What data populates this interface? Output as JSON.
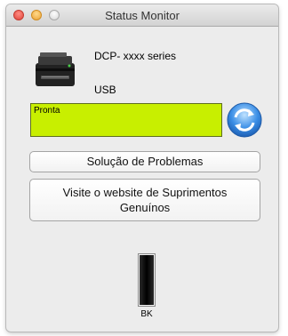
{
  "window": {
    "title": "Status Monitor"
  },
  "device": {
    "name": "DCP- xxxx series",
    "connection": "USB",
    "icon": "printer-icon"
  },
  "status": {
    "text": "Pronta",
    "color": "#c8ef00"
  },
  "buttons": {
    "refresh_icon": "refresh-icon",
    "troubleshoot": "Solução de Problemas",
    "visit_supplies_line1": "Visite o website de Suprimentos",
    "visit_supplies_line2": "Genuínos"
  },
  "toner": {
    "label": "BK",
    "level": 1.0,
    "color": "#000000"
  }
}
